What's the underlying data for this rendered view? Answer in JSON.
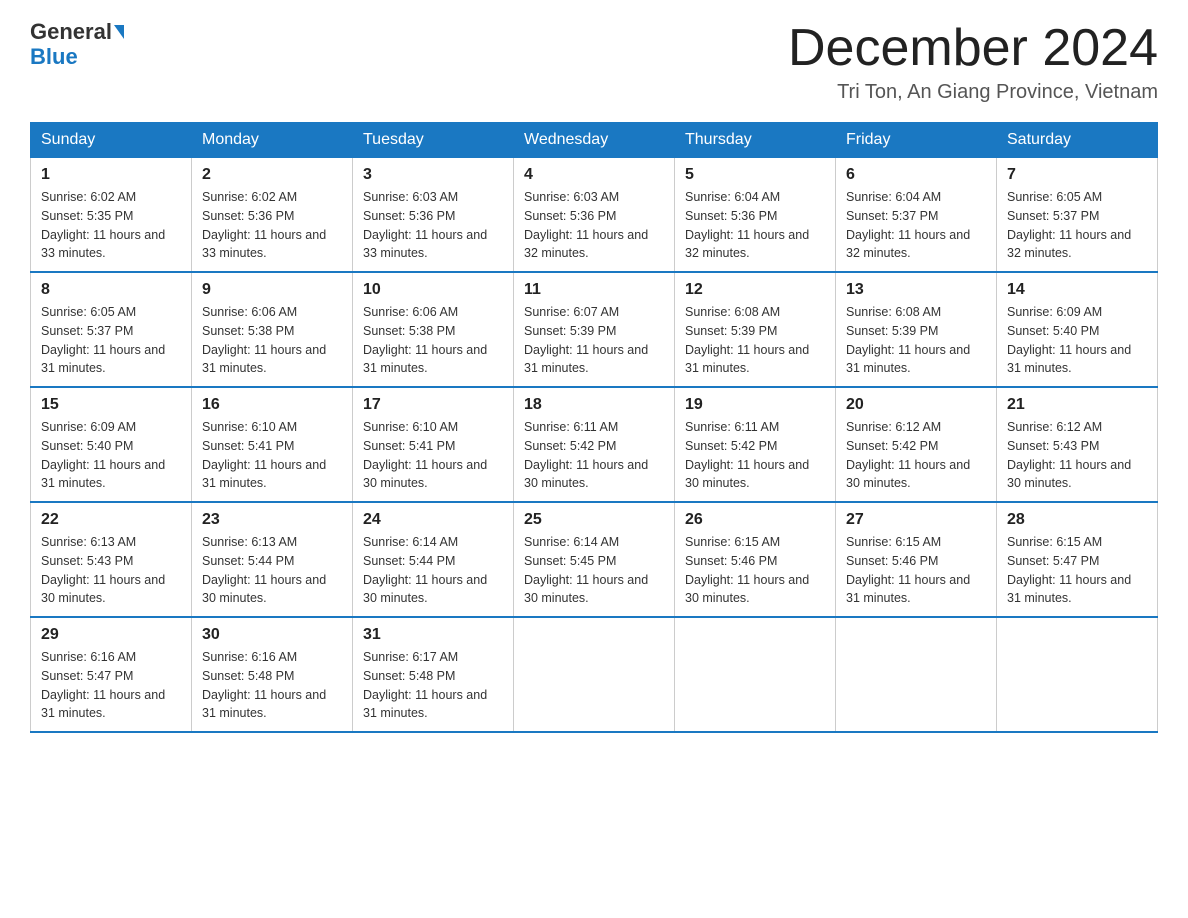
{
  "header": {
    "logo_line1": "General",
    "logo_line2": "Blue",
    "month_title": "December 2024",
    "location": "Tri Ton, An Giang Province, Vietnam"
  },
  "days_of_week": [
    "Sunday",
    "Monday",
    "Tuesday",
    "Wednesday",
    "Thursday",
    "Friday",
    "Saturday"
  ],
  "weeks": [
    [
      {
        "num": "1",
        "sunrise": "6:02 AM",
        "sunset": "5:35 PM",
        "daylight": "11 hours and 33 minutes."
      },
      {
        "num": "2",
        "sunrise": "6:02 AM",
        "sunset": "5:36 PM",
        "daylight": "11 hours and 33 minutes."
      },
      {
        "num": "3",
        "sunrise": "6:03 AM",
        "sunset": "5:36 PM",
        "daylight": "11 hours and 33 minutes."
      },
      {
        "num": "4",
        "sunrise": "6:03 AM",
        "sunset": "5:36 PM",
        "daylight": "11 hours and 32 minutes."
      },
      {
        "num": "5",
        "sunrise": "6:04 AM",
        "sunset": "5:36 PM",
        "daylight": "11 hours and 32 minutes."
      },
      {
        "num": "6",
        "sunrise": "6:04 AM",
        "sunset": "5:37 PM",
        "daylight": "11 hours and 32 minutes."
      },
      {
        "num": "7",
        "sunrise": "6:05 AM",
        "sunset": "5:37 PM",
        "daylight": "11 hours and 32 minutes."
      }
    ],
    [
      {
        "num": "8",
        "sunrise": "6:05 AM",
        "sunset": "5:37 PM",
        "daylight": "11 hours and 31 minutes."
      },
      {
        "num": "9",
        "sunrise": "6:06 AM",
        "sunset": "5:38 PM",
        "daylight": "11 hours and 31 minutes."
      },
      {
        "num": "10",
        "sunrise": "6:06 AM",
        "sunset": "5:38 PM",
        "daylight": "11 hours and 31 minutes."
      },
      {
        "num": "11",
        "sunrise": "6:07 AM",
        "sunset": "5:39 PM",
        "daylight": "11 hours and 31 minutes."
      },
      {
        "num": "12",
        "sunrise": "6:08 AM",
        "sunset": "5:39 PM",
        "daylight": "11 hours and 31 minutes."
      },
      {
        "num": "13",
        "sunrise": "6:08 AM",
        "sunset": "5:39 PM",
        "daylight": "11 hours and 31 minutes."
      },
      {
        "num": "14",
        "sunrise": "6:09 AM",
        "sunset": "5:40 PM",
        "daylight": "11 hours and 31 minutes."
      }
    ],
    [
      {
        "num": "15",
        "sunrise": "6:09 AM",
        "sunset": "5:40 PM",
        "daylight": "11 hours and 31 minutes."
      },
      {
        "num": "16",
        "sunrise": "6:10 AM",
        "sunset": "5:41 PM",
        "daylight": "11 hours and 31 minutes."
      },
      {
        "num": "17",
        "sunrise": "6:10 AM",
        "sunset": "5:41 PM",
        "daylight": "11 hours and 30 minutes."
      },
      {
        "num": "18",
        "sunrise": "6:11 AM",
        "sunset": "5:42 PM",
        "daylight": "11 hours and 30 minutes."
      },
      {
        "num": "19",
        "sunrise": "6:11 AM",
        "sunset": "5:42 PM",
        "daylight": "11 hours and 30 minutes."
      },
      {
        "num": "20",
        "sunrise": "6:12 AM",
        "sunset": "5:42 PM",
        "daylight": "11 hours and 30 minutes."
      },
      {
        "num": "21",
        "sunrise": "6:12 AM",
        "sunset": "5:43 PM",
        "daylight": "11 hours and 30 minutes."
      }
    ],
    [
      {
        "num": "22",
        "sunrise": "6:13 AM",
        "sunset": "5:43 PM",
        "daylight": "11 hours and 30 minutes."
      },
      {
        "num": "23",
        "sunrise": "6:13 AM",
        "sunset": "5:44 PM",
        "daylight": "11 hours and 30 minutes."
      },
      {
        "num": "24",
        "sunrise": "6:14 AM",
        "sunset": "5:44 PM",
        "daylight": "11 hours and 30 minutes."
      },
      {
        "num": "25",
        "sunrise": "6:14 AM",
        "sunset": "5:45 PM",
        "daylight": "11 hours and 30 minutes."
      },
      {
        "num": "26",
        "sunrise": "6:15 AM",
        "sunset": "5:46 PM",
        "daylight": "11 hours and 30 minutes."
      },
      {
        "num": "27",
        "sunrise": "6:15 AM",
        "sunset": "5:46 PM",
        "daylight": "11 hours and 31 minutes."
      },
      {
        "num": "28",
        "sunrise": "6:15 AM",
        "sunset": "5:47 PM",
        "daylight": "11 hours and 31 minutes."
      }
    ],
    [
      {
        "num": "29",
        "sunrise": "6:16 AM",
        "sunset": "5:47 PM",
        "daylight": "11 hours and 31 minutes."
      },
      {
        "num": "30",
        "sunrise": "6:16 AM",
        "sunset": "5:48 PM",
        "daylight": "11 hours and 31 minutes."
      },
      {
        "num": "31",
        "sunrise": "6:17 AM",
        "sunset": "5:48 PM",
        "daylight": "11 hours and 31 minutes."
      },
      null,
      null,
      null,
      null
    ]
  ]
}
